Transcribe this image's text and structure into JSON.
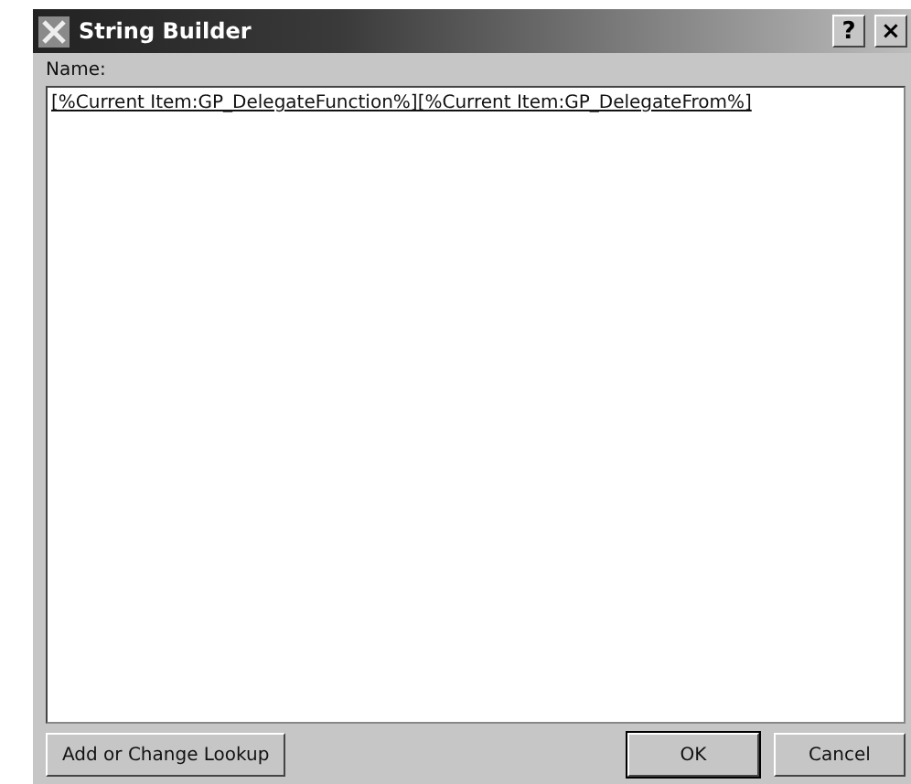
{
  "window": {
    "title": "String Builder",
    "help_button": "?",
    "close_button": "×"
  },
  "name_field": {
    "label": "Name:",
    "value": "[%Current Item:GP_DelegateFunction%][%Current Item:GP_DelegateFrom%]"
  },
  "buttons": [
    {
      "label": "Add or Change Lookup",
      "kind": "left"
    },
    {
      "label": "OK",
      "kind": "default"
    },
    {
      "label": "Cancel",
      "kind": "normal"
    }
  ]
}
